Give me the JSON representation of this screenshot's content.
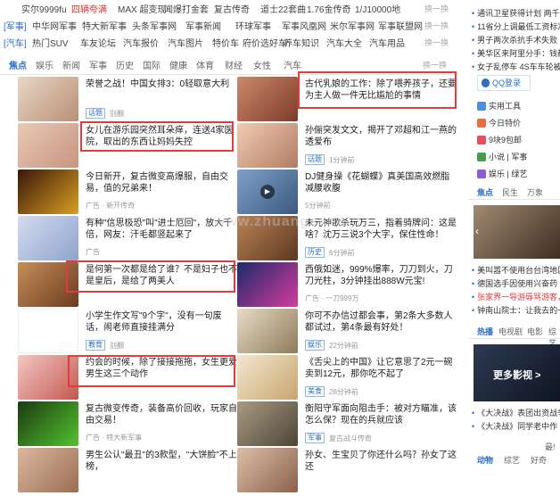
{
  "nav": {
    "rows": [
      {
        "cat": "",
        "links": [
          "实尔9999fu",
          "四辆夸满",
          "MAX 超变现",
          "闻爆打金套",
          "复古传奇",
          "道士22套曲",
          "1.76金传奇",
          "1/J10000地"
        ],
        "more": "换一换"
      },
      {
        "cat": "[军事]",
        "links": [
          "中华网军事",
          "特大新军事",
          "头条军事网",
          "军事新闻",
          "环球军事",
          "军事风凰网",
          "米尔军事网",
          "军事联盟网"
        ],
        "more": "换一换"
      },
      {
        "cat": "[汽车]",
        "links": [
          "热门SUV",
          "车友论坛",
          "汽车报价",
          "汽车图片",
          "特价车",
          "府价选好车",
          "养车知识",
          "汽车大全",
          "汽车用品"
        ],
        "more": "换一换"
      }
    ]
  },
  "tabs": {
    "items": [
      "焦点",
      "娱乐",
      "新闻",
      "军事",
      "历史",
      "国际",
      "健康",
      "体育",
      "财经",
      "女性",
      "汽车"
    ],
    "more": "换一换"
  },
  "feed": {
    "left": [
      {
        "title": "荣誉之战！中国女排3：0轻取意大利",
        "badge": "话题",
        "meta": "别翻"
      },
      {
        "title": "女儿在游乐园突然耳朵痒，连送4家医院，取出的东西让妈妈失控",
        "badge": "",
        "meta": ""
      },
      {
        "title": "今日新开，复古微变高爆服，自由交易，值的兄弟来！",
        "badge": "",
        "meta": "广告 · 新开传奇"
      },
      {
        "title": "有种\"信思极恐\"叫\"进士厄回\"，放大千倍，网友：汗毛都竖起来了",
        "badge": "",
        "meta": "广告"
      },
      {
        "title": "是何第一次都是给了谁？不是妇子也不是皇后，是给了两美人",
        "badge": "",
        "meta": ""
      },
      {
        "title": "小学生作文写\"9个字\"，没有一句废话，闹老师直接挂满分",
        "badge": "教育",
        "meta": "别翻"
      },
      {
        "title": "约会的时候，除了接接拖拖，女生更爱男生这三个动作",
        "badge": "",
        "meta": ""
      },
      {
        "title": "复古微变传奇，装备高价回收，玩家自由交易！",
        "badge": "",
        "meta": "广告 · 特大新军事"
      },
      {
        "title": "男生公认\"最丑\"的3款型，\"大饼脸\"不上榜，",
        "badge": "",
        "meta": ""
      }
    ],
    "right": [
      {
        "title": "古代乳娘的工作：除了喂养孩子，还要为主人做一件无比尴尬的事情",
        "badge": "",
        "meta": ""
      },
      {
        "title": "孙俪突发文文，揭开了邓超和江一燕的透爱布",
        "badge": "话题",
        "meta": "1分钟前"
      },
      {
        "title": "DJ健身操《花蝴蝶》真美国高效燃脂减腰收腹",
        "badge": "",
        "meta": "5分钟前"
      },
      {
        "title": "未元神歌杀玩万三，指着骑牌问：这是啥？沈万三说3个大字，保住性命！",
        "badge": "历史",
        "meta": "6分钟前"
      },
      {
        "title": "西俄如迷，999%爆率，刀刀到火，刀刀光柱，3分钟挂出888W元宝!",
        "badge": "",
        "meta": "广告 · 一刀999万"
      },
      {
        "title": "你可不办信过都会事，第2条大多数人都试过，第4条最有好处！",
        "badge": "娱乐",
        "meta": "22分钟前"
      },
      {
        "title": "《舌尖上的中国》让它意思了2元一碗卖到12元，那你吃不起了",
        "badge": "美食",
        "meta": "28分钟前"
      },
      {
        "title": "衡阳守军面向阻击手：被对方瞄准，该怎么保？现在的兵就应该",
        "badge": "军事",
        "meta": "复古战斗传奇"
      },
      {
        "title": "孙女、生宝贝了你还什么吗？孙女了这还",
        "badge": "",
        "meta": ""
      }
    ]
  },
  "sidebar": {
    "news": [
      "通讯卫星获得计划 两千万中国人",
      "11省分上调最低工资标准",
      "男子两次杀抗手术失败 妻子",
      "美华区来阿里分手：钱都谈了",
      "女子乱停车 4S车车轮被人拆"
    ],
    "qq_label": "QQ登录",
    "services": [
      "实用工具",
      "今日特价",
      "9块9包邮",
      "小说 | 军事",
      "娱乐 | 绿艺"
    ],
    "tabs1": [
      "焦点",
      "民生",
      "万象"
    ],
    "news2": [
      "美叫嚣不使用台台湾地区在",
      "德国选手因使用兴奋药",
      "张家界一导游辱骂游客，网",
      "钟南山院士：让我去的一定"
    ],
    "tabs2": [
      "热播",
      "电视剧",
      "电影",
      "综艺"
    ],
    "promo": "更多影视 >",
    "news3": [
      "《大决战》表团出资战争",
      "《大决战》同学老中作"
    ],
    "tabs3": [
      "动物",
      "综艺",
      "好奇"
    ],
    "pagecount": "最!"
  },
  "watermark": "www.zhuangcanu",
  "colors": {
    "accent": "#2a6fc9",
    "highlight": "#e23b3b"
  }
}
